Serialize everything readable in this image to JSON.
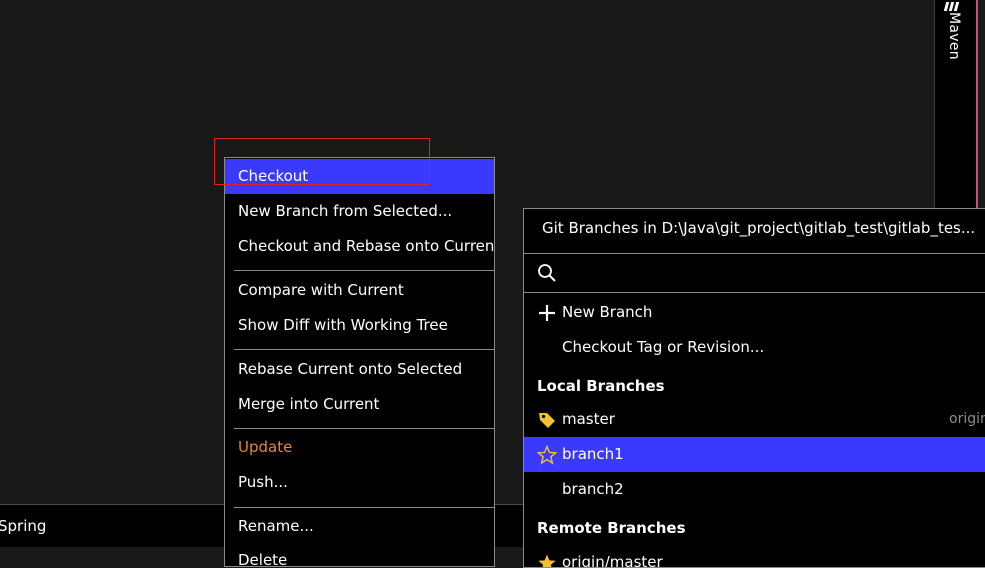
{
  "right_toolbar": {
    "maven_label": "Maven"
  },
  "bottom_bar": {
    "spring_label": "Spring"
  },
  "context_menu": {
    "items": [
      {
        "label": "Checkout",
        "selected": true
      },
      {
        "label": "New Branch from Selected..."
      },
      {
        "label": "Checkout and Rebase onto Current"
      },
      {
        "label": "Compare with Current"
      },
      {
        "label": "Show Diff with Working Tree"
      },
      {
        "label": "Rebase Current onto Selected"
      },
      {
        "label": "Merge into Current"
      },
      {
        "label": "Update",
        "color": "#e08a2c"
      },
      {
        "label": "Push..."
      },
      {
        "label": "Rename..."
      },
      {
        "label": "Delete"
      }
    ]
  },
  "branches_popup": {
    "title": "Git Branches in D:\\Java\\git_project\\gitlab_test\\gitlab_tes...",
    "search_placeholder": "",
    "new_branch_label": "New Branch",
    "checkout_tag_label": "Checkout Tag or Revision...",
    "local_header": "Local Branches",
    "local_branches": [
      {
        "name": "master",
        "icon": "tag-icon",
        "trail": "origin"
      },
      {
        "name": "branch1",
        "icon": "star-icon",
        "selected": true
      },
      {
        "name": "branch2"
      }
    ],
    "remote_header": "Remote Branches",
    "remote_branches": [
      {
        "name": "origin/master",
        "icon": "star-icon"
      }
    ]
  },
  "colors": {
    "selection": "#3a3aff",
    "highlight_box": "#e02020",
    "tag": "#f2c230",
    "update_text": "#e08a2c"
  }
}
